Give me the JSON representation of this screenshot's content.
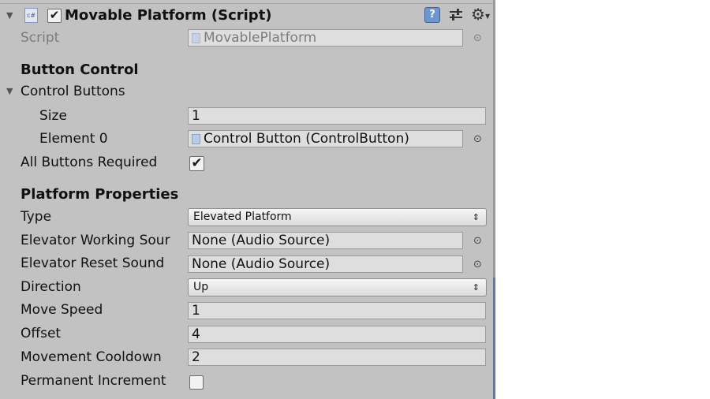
{
  "component": {
    "title": "Movable Platform (Script)",
    "enabled": true,
    "script_label": "Script",
    "script_value": "MovablePlatform",
    "cs_icon_text": "c#"
  },
  "header_icons": {
    "help": "help-book-icon",
    "presets": "presets-sliders-icon",
    "settings": "gear-icon"
  },
  "button_control": {
    "heading": "Button Control",
    "control_buttons_label": "Control Buttons",
    "size_label": "Size",
    "size_value": "1",
    "element0_label": "Element 0",
    "element0_value": "Control Button (ControlButton)",
    "all_required_label": "All Buttons Required",
    "all_required_checked": true
  },
  "platform_properties": {
    "heading": "Platform Properties",
    "type_label": "Type",
    "type_value": "Elevated Platform",
    "working_sound_label": "Elevator Working Sour",
    "working_sound_value": "None (Audio Source)",
    "reset_sound_label": "Elevator Reset Sound",
    "reset_sound_value": "None (Audio Source)",
    "direction_label": "Direction",
    "direction_value": "Up",
    "move_speed_label": "Move Speed",
    "move_speed_value": "1",
    "offset_label": "Offset",
    "offset_value": "4",
    "cooldown_label": "Movement Cooldown",
    "cooldown_value": "2",
    "permanent_label": "Permanent Increment",
    "permanent_checked": false
  },
  "glyphs": {
    "fold_open": "▼",
    "check": "✔",
    "picker": "⊙",
    "dropdown": "⇕",
    "help": "?",
    "gear": "⚙"
  },
  "colors": {
    "inspector_bg": "#c2c2c2",
    "field_bg": "#dedede",
    "accent": "#5b7bb0"
  }
}
